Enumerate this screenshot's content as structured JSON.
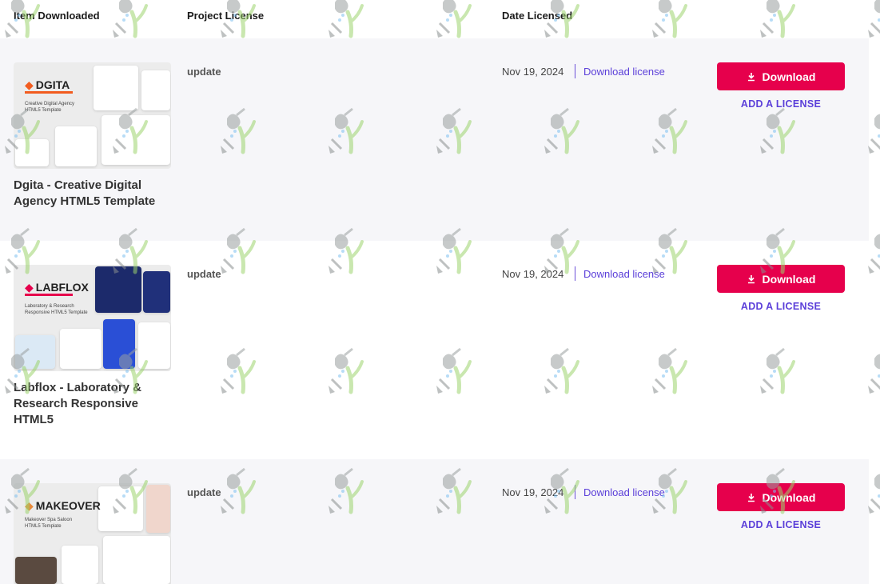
{
  "headers": {
    "item": "Item Downloaded",
    "license": "Project License",
    "date": "Date Licensed"
  },
  "items": [
    {
      "brand": "DGITA",
      "thumb_tagline": "Creative Digital Agency HTML5 Template",
      "title": "Dgita - Creative Digital Agency HTML5 Template",
      "license": "update",
      "date": "Nov 19, 2024",
      "download_license": "Download license",
      "download": "Download",
      "add_license": "ADD A LICENSE"
    },
    {
      "brand": "LABFLOX",
      "thumb_tagline": "Laboratory & Research Responsive HTML5 Template",
      "title": "Labflox - Laboratory & Research Responsive HTML5",
      "license": "update",
      "date": "Nov 19, 2024",
      "download_license": "Download license",
      "download": "Download",
      "add_license": "ADD A LICENSE"
    },
    {
      "brand": "MAKEOVER",
      "thumb_tagline": "Makeover Spa Saloon HTML5 Template",
      "title": "",
      "license": "update",
      "date": "Nov 19, 2024",
      "download_license": "Download license",
      "download": "Download",
      "add_license": "ADD A LICENSE"
    }
  ],
  "colors": {
    "accent": "#e6004c",
    "link": "#5b3fd9",
    "row_shade": "#f6f6f9",
    "brand_orange": "#f25c1f"
  },
  "icons": {
    "download": "download-arrow-icon",
    "watermark": "watering-can-shovel-sprout-icon"
  }
}
